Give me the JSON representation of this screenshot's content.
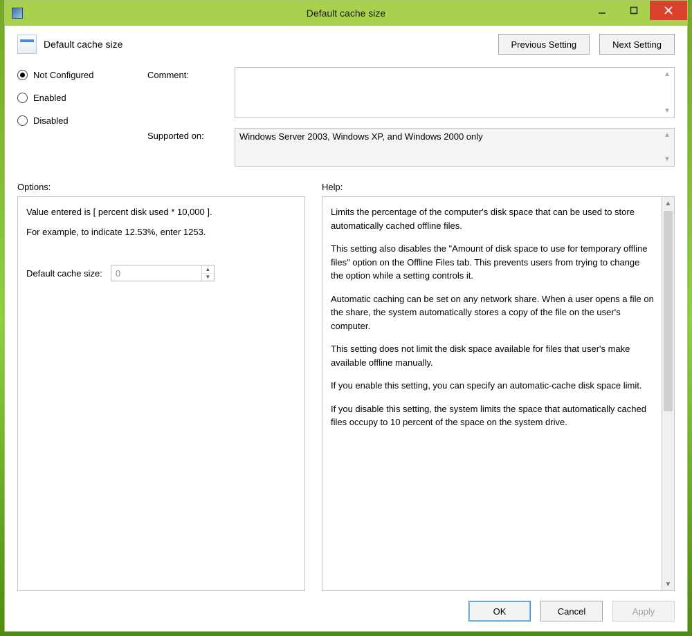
{
  "window": {
    "title": "Default cache size"
  },
  "header": {
    "title": "Default cache size",
    "prev_button": "Previous Setting",
    "next_button": "Next Setting"
  },
  "state": {
    "radios": [
      {
        "label": "Not Configured",
        "selected": true
      },
      {
        "label": "Enabled",
        "selected": false
      },
      {
        "label": "Disabled",
        "selected": false
      }
    ],
    "comment_label": "Comment:",
    "comment_value": "",
    "supported_label": "Supported on:",
    "supported_value": "Windows Server 2003, Windows XP, and Windows 2000 only"
  },
  "sections": {
    "options_label": "Options:",
    "help_label": "Help:"
  },
  "options": {
    "line1": "Value entered is [ percent disk used * 10,000 ].",
    "line2": "For example, to indicate 12.53%, enter 1253.",
    "field_label": "Default cache size:",
    "field_value": "0"
  },
  "help": {
    "p1": "Limits the percentage of the computer's disk space that can be used to store automatically cached offline files.",
    "p2": "This setting also disables the \"Amount of disk space to use for temporary offline files\" option on the Offline Files tab. This prevents users from trying to change the option while a setting controls it.",
    "p3": "Automatic caching can be set on any network share. When a user opens a file on the share, the system automatically stores a copy of the file on the user's computer.",
    "p4": "This setting does not limit the disk space available for files that user's make available offline manually.",
    "p5": "If you enable this setting, you can specify an automatic-cache disk space limit.",
    "p6": "If you disable this setting, the system limits the space that automatically cached files occupy to 10 percent of the space on the system drive."
  },
  "footer": {
    "ok": "OK",
    "cancel": "Cancel",
    "apply": "Apply"
  }
}
